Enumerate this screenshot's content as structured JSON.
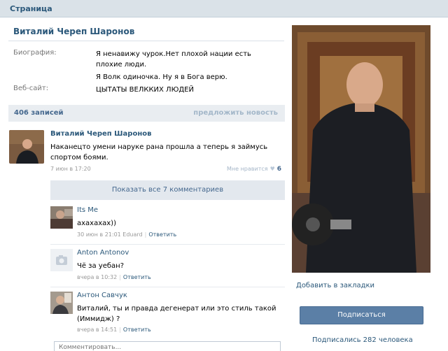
{
  "header": {
    "title": "Страница"
  },
  "profile": {
    "name": "Виталий Череп Шаронов",
    "bio_label": "Биография:",
    "bio_lines": [
      "Я ненавижу чурок.Нет плохой нации есть плохие люди.",
      "Я Волк одиночка. Ну я в Бога верю."
    ],
    "website_label": "Веб-сайт:",
    "website_value": "ЦЫТАТЫ ВЕЛККИХ ЛЮДЕЙ"
  },
  "wall": {
    "count": "406 записей",
    "suggest": "предложить новость"
  },
  "post": {
    "author": "Виталий Череп Шаронов",
    "text": "Наканецто умени наруке рана прошла а теперь я займусь спортом боями.",
    "date": "7 июн в 17:20",
    "like_label": "Мне нравится",
    "like_count": "6"
  },
  "comments": {
    "show_all": "Показать все 7 комментариев",
    "reply_label": "Ответить",
    "items": [
      {
        "author": "Its Me",
        "text": "ахахахах))",
        "meta": "30 июн в 21:01 Eduard"
      },
      {
        "author": "Anton Antonov",
        "text": "Чё за уебан?",
        "meta": "вчера в 10:32"
      },
      {
        "author": "Антон Савчук",
        "text": "Виталий, ты и правда дегенерат или это стиль такой (Иммидж) ?",
        "meta": "вчера в 14:51"
      }
    ],
    "input_placeholder": "Комментировать..."
  },
  "sidebar": {
    "bookmark": "Добавить в закладки",
    "subscribe": "Подписаться",
    "subscribers": "Подписались 282 человека"
  },
  "colors": {
    "link": "#2b587a",
    "button": "#5b7fa6",
    "header_bg": "#dae2e8"
  }
}
